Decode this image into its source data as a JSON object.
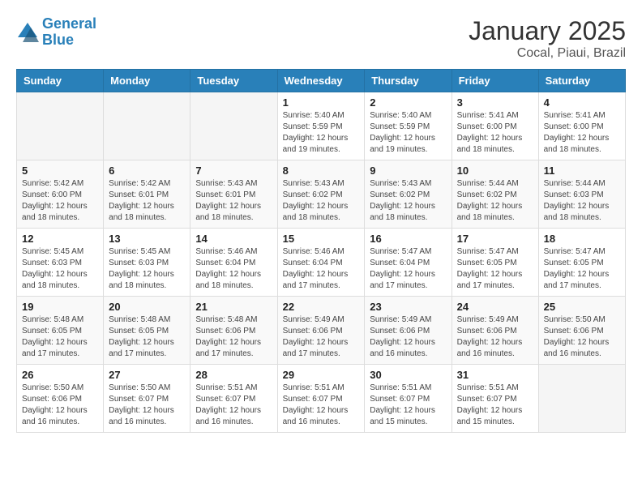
{
  "header": {
    "logo_line1": "General",
    "logo_line2": "Blue",
    "title": "January 2025",
    "subtitle": "Cocal, Piaui, Brazil"
  },
  "weekdays": [
    "Sunday",
    "Monday",
    "Tuesday",
    "Wednesday",
    "Thursday",
    "Friday",
    "Saturday"
  ],
  "weeks": [
    [
      {
        "day": "",
        "info": ""
      },
      {
        "day": "",
        "info": ""
      },
      {
        "day": "",
        "info": ""
      },
      {
        "day": "1",
        "info": "Sunrise: 5:40 AM\nSunset: 5:59 PM\nDaylight: 12 hours\nand 19 minutes."
      },
      {
        "day": "2",
        "info": "Sunrise: 5:40 AM\nSunset: 5:59 PM\nDaylight: 12 hours\nand 19 minutes."
      },
      {
        "day": "3",
        "info": "Sunrise: 5:41 AM\nSunset: 6:00 PM\nDaylight: 12 hours\nand 18 minutes."
      },
      {
        "day": "4",
        "info": "Sunrise: 5:41 AM\nSunset: 6:00 PM\nDaylight: 12 hours\nand 18 minutes."
      }
    ],
    [
      {
        "day": "5",
        "info": "Sunrise: 5:42 AM\nSunset: 6:00 PM\nDaylight: 12 hours\nand 18 minutes."
      },
      {
        "day": "6",
        "info": "Sunrise: 5:42 AM\nSunset: 6:01 PM\nDaylight: 12 hours\nand 18 minutes."
      },
      {
        "day": "7",
        "info": "Sunrise: 5:43 AM\nSunset: 6:01 PM\nDaylight: 12 hours\nand 18 minutes."
      },
      {
        "day": "8",
        "info": "Sunrise: 5:43 AM\nSunset: 6:02 PM\nDaylight: 12 hours\nand 18 minutes."
      },
      {
        "day": "9",
        "info": "Sunrise: 5:43 AM\nSunset: 6:02 PM\nDaylight: 12 hours\nand 18 minutes."
      },
      {
        "day": "10",
        "info": "Sunrise: 5:44 AM\nSunset: 6:02 PM\nDaylight: 12 hours\nand 18 minutes."
      },
      {
        "day": "11",
        "info": "Sunrise: 5:44 AM\nSunset: 6:03 PM\nDaylight: 12 hours\nand 18 minutes."
      }
    ],
    [
      {
        "day": "12",
        "info": "Sunrise: 5:45 AM\nSunset: 6:03 PM\nDaylight: 12 hours\nand 18 minutes."
      },
      {
        "day": "13",
        "info": "Sunrise: 5:45 AM\nSunset: 6:03 PM\nDaylight: 12 hours\nand 18 minutes."
      },
      {
        "day": "14",
        "info": "Sunrise: 5:46 AM\nSunset: 6:04 PM\nDaylight: 12 hours\nand 18 minutes."
      },
      {
        "day": "15",
        "info": "Sunrise: 5:46 AM\nSunset: 6:04 PM\nDaylight: 12 hours\nand 17 minutes."
      },
      {
        "day": "16",
        "info": "Sunrise: 5:47 AM\nSunset: 6:04 PM\nDaylight: 12 hours\nand 17 minutes."
      },
      {
        "day": "17",
        "info": "Sunrise: 5:47 AM\nSunset: 6:05 PM\nDaylight: 12 hours\nand 17 minutes."
      },
      {
        "day": "18",
        "info": "Sunrise: 5:47 AM\nSunset: 6:05 PM\nDaylight: 12 hours\nand 17 minutes."
      }
    ],
    [
      {
        "day": "19",
        "info": "Sunrise: 5:48 AM\nSunset: 6:05 PM\nDaylight: 12 hours\nand 17 minutes."
      },
      {
        "day": "20",
        "info": "Sunrise: 5:48 AM\nSunset: 6:05 PM\nDaylight: 12 hours\nand 17 minutes."
      },
      {
        "day": "21",
        "info": "Sunrise: 5:48 AM\nSunset: 6:06 PM\nDaylight: 12 hours\nand 17 minutes."
      },
      {
        "day": "22",
        "info": "Sunrise: 5:49 AM\nSunset: 6:06 PM\nDaylight: 12 hours\nand 17 minutes."
      },
      {
        "day": "23",
        "info": "Sunrise: 5:49 AM\nSunset: 6:06 PM\nDaylight: 12 hours\nand 16 minutes."
      },
      {
        "day": "24",
        "info": "Sunrise: 5:49 AM\nSunset: 6:06 PM\nDaylight: 12 hours\nand 16 minutes."
      },
      {
        "day": "25",
        "info": "Sunrise: 5:50 AM\nSunset: 6:06 PM\nDaylight: 12 hours\nand 16 minutes."
      }
    ],
    [
      {
        "day": "26",
        "info": "Sunrise: 5:50 AM\nSunset: 6:06 PM\nDaylight: 12 hours\nand 16 minutes."
      },
      {
        "day": "27",
        "info": "Sunrise: 5:50 AM\nSunset: 6:07 PM\nDaylight: 12 hours\nand 16 minutes."
      },
      {
        "day": "28",
        "info": "Sunrise: 5:51 AM\nSunset: 6:07 PM\nDaylight: 12 hours\nand 16 minutes."
      },
      {
        "day": "29",
        "info": "Sunrise: 5:51 AM\nSunset: 6:07 PM\nDaylight: 12 hours\nand 16 minutes."
      },
      {
        "day": "30",
        "info": "Sunrise: 5:51 AM\nSunset: 6:07 PM\nDaylight: 12 hours\nand 15 minutes."
      },
      {
        "day": "31",
        "info": "Sunrise: 5:51 AM\nSunset: 6:07 PM\nDaylight: 12 hours\nand 15 minutes."
      },
      {
        "day": "",
        "info": ""
      }
    ]
  ]
}
